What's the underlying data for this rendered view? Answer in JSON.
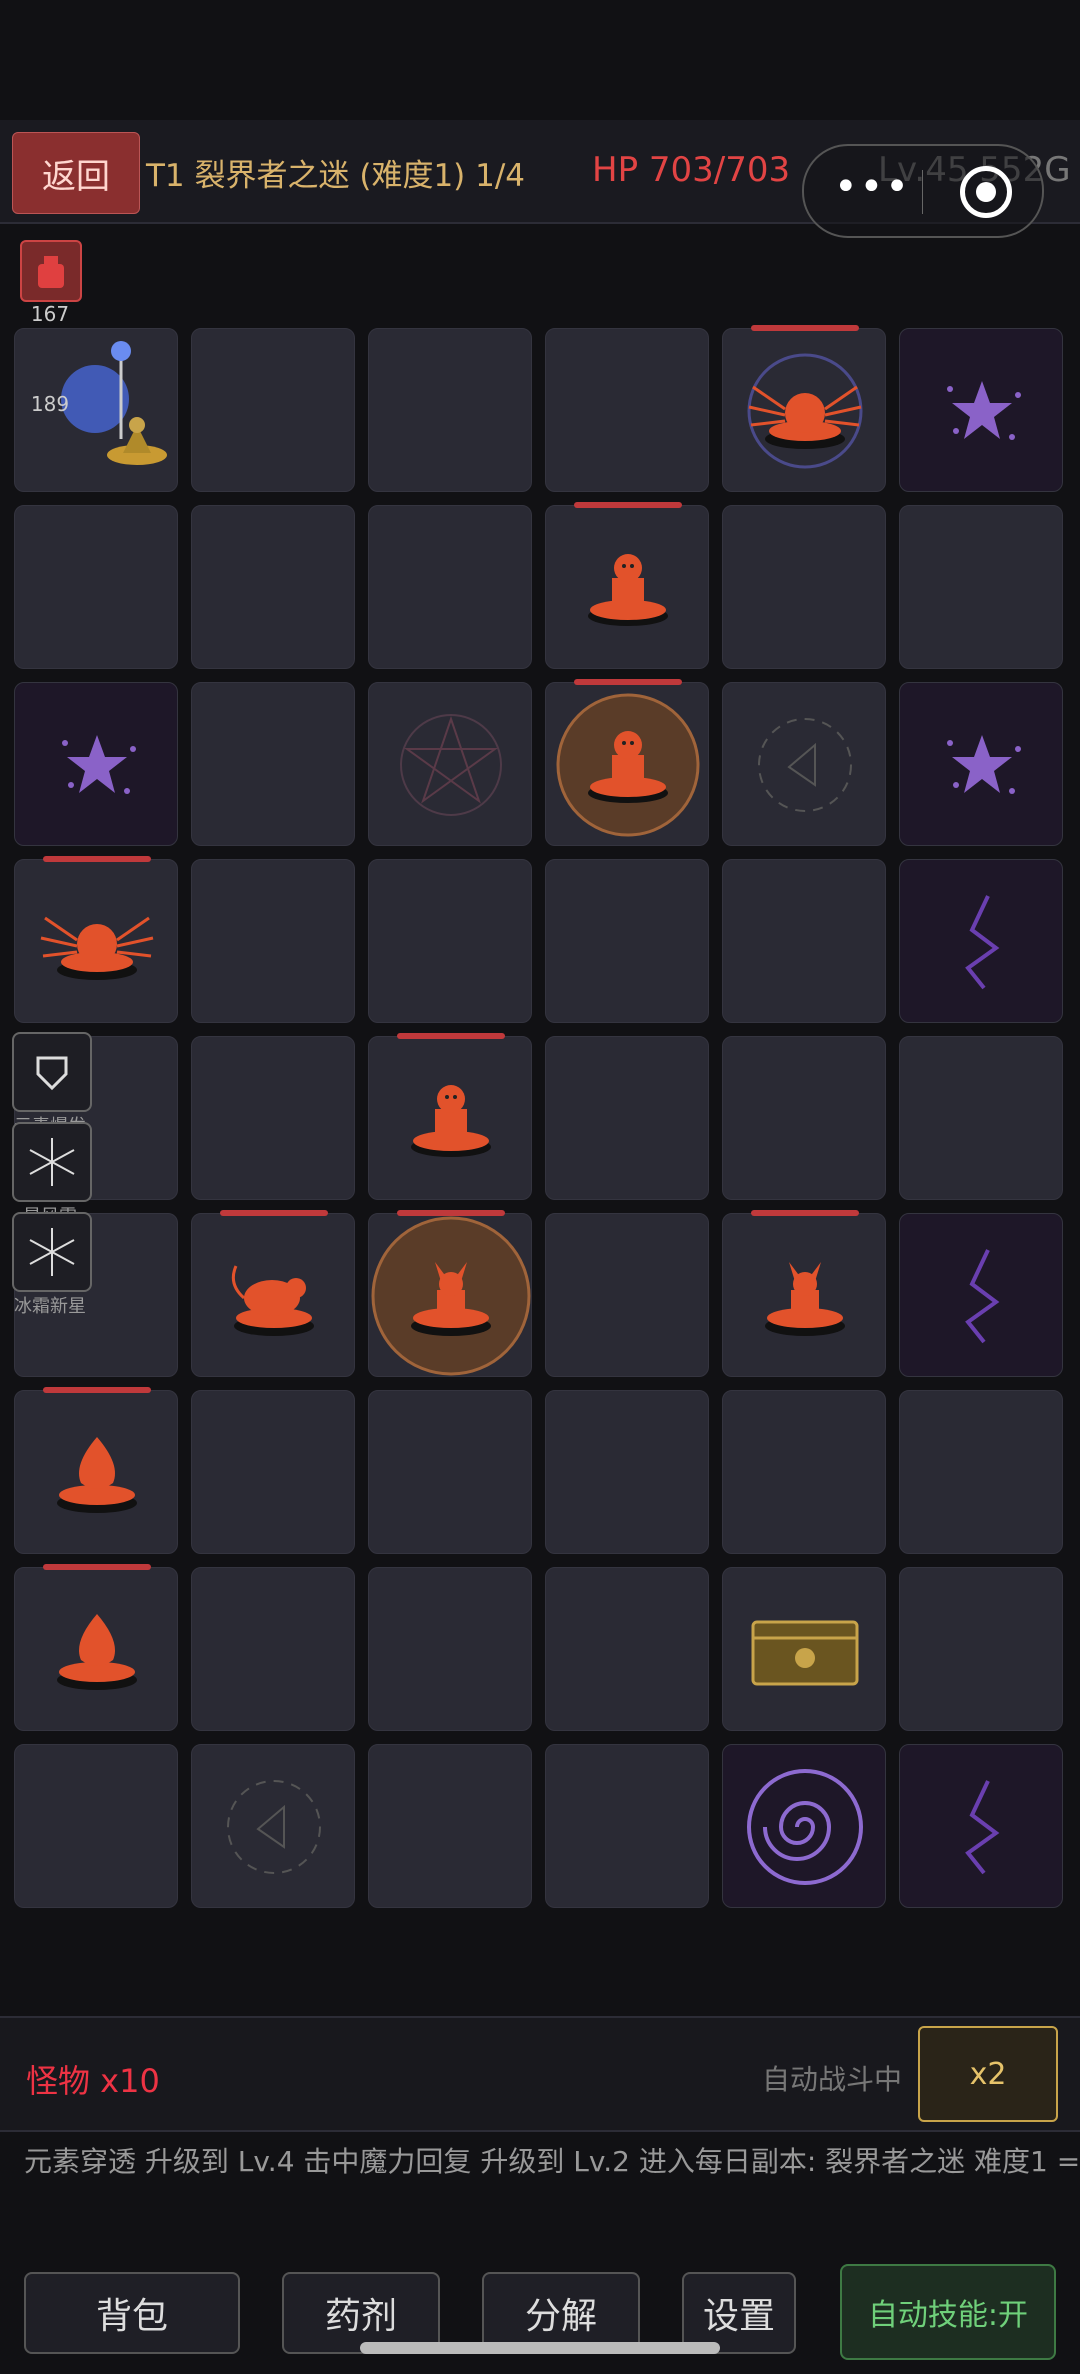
{
  "header": {
    "back_label": "返回",
    "title": "T1 裂界者之迷 (难度1) 1/4",
    "hp": "HP 703/703",
    "level_gold": "Lv.45 552G"
  },
  "potions": {
    "red_count": "167",
    "blue_count": "189"
  },
  "skills": [
    {
      "name": "元素爆发",
      "icon": "shield-icon"
    },
    {
      "name": "星风雪",
      "icon": "snowflake-icon"
    },
    {
      "name": "冰霜新星",
      "icon": "snowflake-icon"
    }
  ],
  "board": {
    "rows": 9,
    "cols": 6,
    "cells": [
      [
        "player",
        "",
        "",
        "",
        "spider_boss",
        "star"
      ],
      [
        "",
        "",
        "",
        "monster",
        "",
        ""
      ],
      [
        "star",
        "",
        "pentagram",
        "monster_elite",
        "portal_dim",
        "star"
      ],
      [
        "spider",
        "",
        "",
        "",
        "",
        "rift"
      ],
      [
        "",
        "",
        "monster",
        "",
        "",
        ""
      ],
      [
        "",
        "rat",
        "fox_elite",
        "",
        "fox",
        "rift"
      ],
      [
        "flame",
        "",
        "",
        "",
        "",
        ""
      ],
      [
        "flame",
        "",
        "",
        "",
        "chest",
        ""
      ],
      [
        "",
        "portal_dim",
        "",
        "",
        "vortex",
        "rift"
      ]
    ],
    "colors": {
      "enemy": "#e2522b",
      "purple": "#8a62c8",
      "gold": "#c8a44a"
    }
  },
  "status": {
    "monsters": "怪物 x10",
    "auto_battle": "自动战斗中",
    "speed": "x2"
  },
  "log": "元素穿透 升级到 Lv.4 击中魔力回复 升级到 Lv.2 进入每日副本: 裂界者之迷 难度1 ===",
  "buttons": {
    "bag": "背包",
    "potion": "药剂",
    "decompose": "分解",
    "settings": "设置",
    "auto_skill": "自动技能:开"
  }
}
